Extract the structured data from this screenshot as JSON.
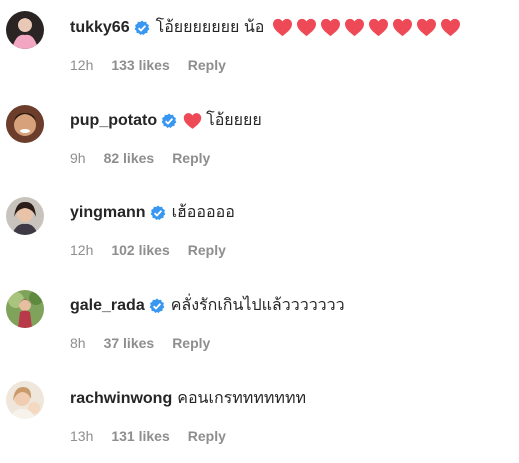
{
  "accent": {
    "verified": "#3897f0",
    "heart": "#ed4956",
    "meta": "#8e8e8e"
  },
  "comments": [
    {
      "username": "tukky66",
      "verified": true,
      "text": "โอ้ยยยยยยย น้อ",
      "lead_heart": false,
      "trailing_hearts": 8,
      "time": "12h",
      "likes": "133 likes",
      "reply": "Reply",
      "avatar_icon": "avatar-photo"
    },
    {
      "username": "pup_potato",
      "verified": true,
      "text": "โอ้ยยยย",
      "lead_heart": true,
      "trailing_hearts": 0,
      "time": "9h",
      "likes": "82 likes",
      "reply": "Reply",
      "avatar_icon": "avatar-photo"
    },
    {
      "username": "yingmann",
      "verified": true,
      "text": "เฮ้อออออ",
      "lead_heart": false,
      "trailing_hearts": 0,
      "time": "12h",
      "likes": "102 likes",
      "reply": "Reply",
      "avatar_icon": "avatar-photo"
    },
    {
      "username": "gale_rada",
      "verified": true,
      "text": "คลั่งรักเกินไปแล้ววววววว",
      "lead_heart": false,
      "trailing_hearts": 0,
      "time": "8h",
      "likes": "37 likes",
      "reply": "Reply",
      "avatar_icon": "avatar-photo"
    },
    {
      "username": "rachwinwong",
      "verified": false,
      "text": "คอนเกรททททททท",
      "lead_heart": false,
      "trailing_hearts": 0,
      "time": "13h",
      "likes": "131 likes",
      "reply": "Reply",
      "avatar_icon": "avatar-photo"
    }
  ]
}
